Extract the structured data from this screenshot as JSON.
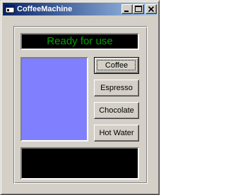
{
  "window": {
    "title": "CoffeeMachine",
    "icon": "app-window-icon",
    "controls": [
      "minimize-icon",
      "maximize-icon",
      "close-icon"
    ]
  },
  "status": {
    "text": "Ready for use",
    "text_color": "#00a000",
    "background": "#000000"
  },
  "preview": {
    "color": "#8080ff"
  },
  "buttons": {
    "coffee": "Coffee",
    "espresso": "Espresso",
    "chocolate": "Chocolate",
    "hot_water": "Hot Water"
  },
  "output": {
    "text": "",
    "background": "#000000"
  },
  "colors": {
    "face": "#d4d0c8",
    "title_start": "#0a246a",
    "title_end": "#a6caf0"
  }
}
